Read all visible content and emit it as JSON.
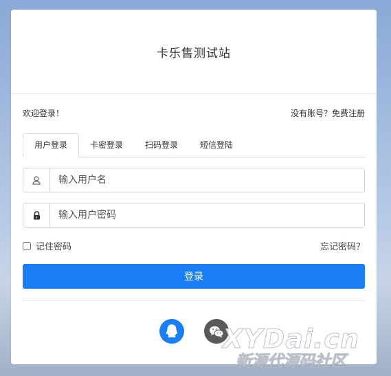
{
  "header": {
    "title": "卡乐售测试站"
  },
  "greeting": "欢迎登录！",
  "register_link": "没有账号？免费注册",
  "tabs": [
    {
      "label": "用户登录",
      "active": true
    },
    {
      "label": "卡密登录",
      "active": false
    },
    {
      "label": "扫码登录",
      "active": false
    },
    {
      "label": "短信登陆",
      "active": false
    }
  ],
  "form": {
    "username_placeholder": "输入用户名",
    "password_placeholder": "输入用户密码",
    "remember_label": "记住密码",
    "forgot_label": "忘记密码？",
    "login_label": "登录"
  },
  "social": [
    {
      "name": "qq-icon",
      "color": "#1a7ff5"
    },
    {
      "name": "wechat-icon",
      "color": "#5a5a5a"
    }
  ],
  "watermark": {
    "main": "XYDai.cn",
    "sub": "新源代源码社区"
  },
  "colors": {
    "primary": "#1a7ff5"
  }
}
